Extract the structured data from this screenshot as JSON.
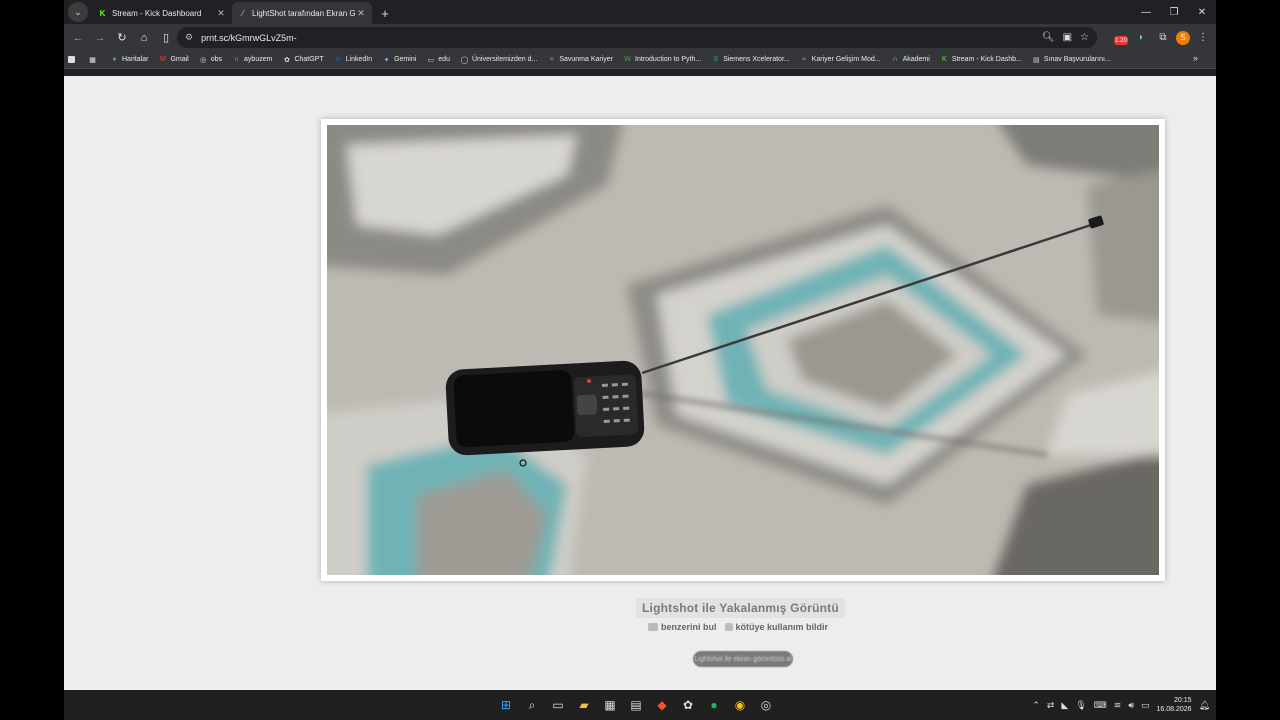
{
  "browser": {
    "tabs": [
      {
        "label": "Stream - Kick Dashboard",
        "favicon": "kick-icon",
        "active": false
      },
      {
        "label": "LightShot tarafından Ekran Görü",
        "favicon": "feather-icon",
        "active": true
      }
    ],
    "address": "prnt.sc/kGmrwGLvZ5m-",
    "bookmarks": [
      {
        "label": "Haritalar",
        "icon": "maps-pin-icon",
        "color": "#4caf50"
      },
      {
        "label": "Gmail",
        "icon": "gmail-icon",
        "color": "#ea4335"
      },
      {
        "label": "obs",
        "icon": "obs-icon",
        "color": "#dddddd"
      },
      {
        "label": "aybuzem",
        "icon": "aybu-icon",
        "color": "#80cbc4"
      },
      {
        "label": "ChatGPT",
        "icon": "chatgpt-icon",
        "color": "#dddddd"
      },
      {
        "label": "LinkedIn",
        "icon": "linkedin-icon",
        "color": "#0a66c2"
      },
      {
        "label": "Gemini",
        "icon": "gemini-icon",
        "color": "#8ab4f8"
      },
      {
        "label": "edu",
        "icon": "folder-icon",
        "color": "#dddddd"
      },
      {
        "label": "Üniversitemizden d...",
        "icon": "globe-icon",
        "color": "#dddddd"
      },
      {
        "label": "Savunma Kariyer",
        "icon": "kariyer-icon",
        "color": "#9ccc65"
      },
      {
        "label": "Introduction to Pyth...",
        "icon": "w-icon",
        "color": "#43a047"
      },
      {
        "label": "Siemens Xcelerator...",
        "icon": "siemens-icon",
        "color": "#26a69a"
      },
      {
        "label": "Kariyer Gelişim Mod...",
        "icon": "kariyer-icon",
        "color": "#9ccc65"
      },
      {
        "label": "Akademi",
        "icon": "akademi-icon",
        "color": "#80cbc4"
      },
      {
        "label": "Stream - Kick Dashb...",
        "icon": "kick-icon",
        "color": "#53fc18"
      },
      {
        "label": "Sınav Başvurularını...",
        "icon": "doc-icon",
        "color": "#dddddd"
      }
    ]
  },
  "page": {
    "caption_title": "Lightshot ile Yakalanmış Görüntü",
    "link_similar": "benzerini bul",
    "link_report": "kötüye kullanım bildir",
    "pill_text": "Lightshot ile ekran görüntüsü al"
  },
  "taskbar": {
    "time": "20:15",
    "date": "16.08.2026"
  },
  "colors": {
    "kick_green": "#53fc18",
    "page_bg": "#ededed",
    "chrome_dark": "#202124",
    "toolbar": "#35363a"
  }
}
